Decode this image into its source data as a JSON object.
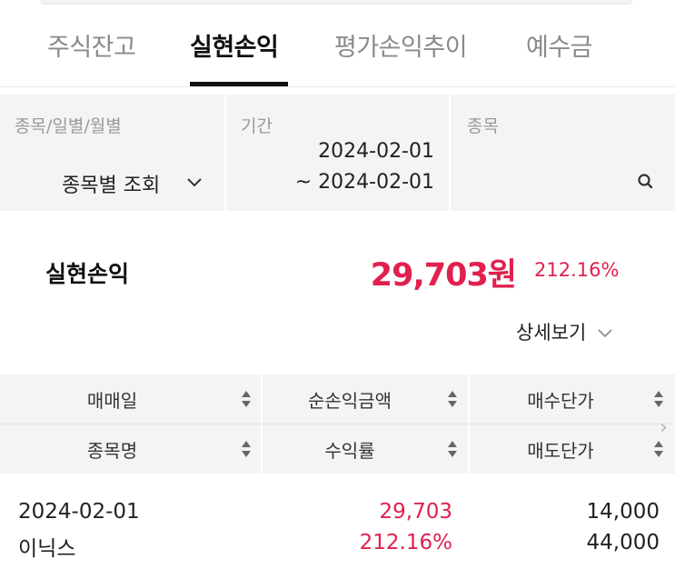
{
  "tabs": [
    {
      "label": "주식잔고"
    },
    {
      "label": "실현손익"
    },
    {
      "label": "평가손익추이"
    },
    {
      "label": "예수금"
    }
  ],
  "filter": {
    "type_label": "종목/일별/월별",
    "type_value": "종목별 조회",
    "period_label": "기간",
    "period_start": "2024-02-01",
    "period_end": "~ 2024-02-01",
    "stock_label": "종목",
    "stock_value": ""
  },
  "summary": {
    "label": "실현손익",
    "amount": "29,703원",
    "rate": "212.16%"
  },
  "detail_link": "상세보기",
  "table": {
    "headers_row1": [
      "매매일",
      "순손익금액",
      "매수단가"
    ],
    "headers_row2": [
      "종목명",
      "수익률",
      "매도단가"
    ],
    "rows": [
      {
        "date": "2024-02-01",
        "name": "이닉스",
        "net_profit": "29,703",
        "return_rate": "212.16%",
        "buy_price": "14,000",
        "sell_price": "44,000"
      }
    ]
  },
  "colors": {
    "accent_red": "#e0204e",
    "panel_gray": "#f4f4f4"
  }
}
